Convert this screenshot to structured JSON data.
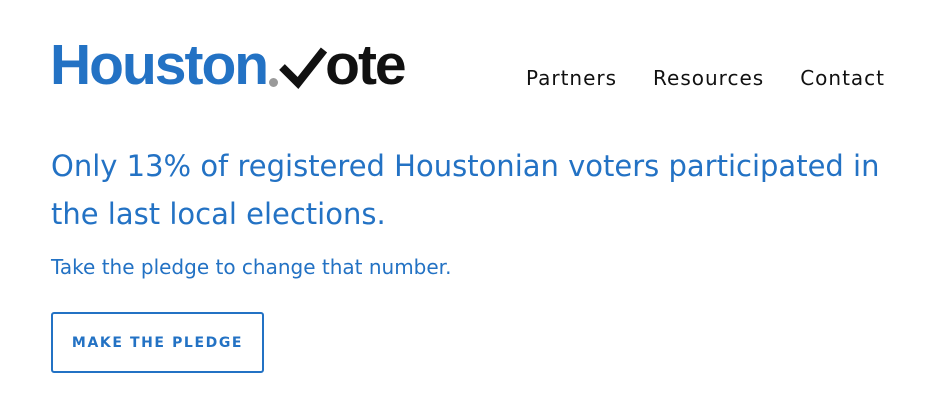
{
  "logo": {
    "word_1": "Houston",
    "word_2": "ote",
    "dot_icon": "dot-icon",
    "check_icon": "checkmark-icon",
    "colors": {
      "primary": "#2372c4",
      "dot": "#9a9a9a",
      "dark": "#111111"
    }
  },
  "nav": {
    "items": [
      {
        "label": "Partners"
      },
      {
        "label": "Resources"
      },
      {
        "label": "Contact"
      }
    ]
  },
  "hero": {
    "headline": "Only 13% of registered Houstonian voters participated in the last local elections.",
    "subhead": "Take the pledge to change that number.",
    "cta_label": "MAKE THE PLEDGE"
  }
}
